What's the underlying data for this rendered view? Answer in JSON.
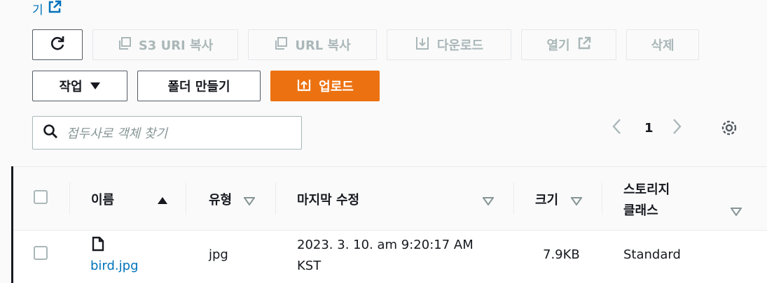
{
  "top_link": {
    "label": "기"
  },
  "toolbar": {
    "refresh_label": "",
    "copy_s3_uri": "S3 URI 복사",
    "copy_url": "URL 복사",
    "download": "다운로드",
    "open": "열기",
    "delete": "삭제",
    "actions": "작업",
    "create_folder": "폴더 만들기",
    "upload": "업로드"
  },
  "search": {
    "placeholder": "접두사로 객체 찾기"
  },
  "pagination": {
    "current_page": "1"
  },
  "table": {
    "columns": {
      "name": "이름",
      "type": "유형",
      "last_modified": "마지막 수정",
      "size": "크기",
      "storage_class_line1": "스토리지",
      "storage_class_line2": "클래스"
    },
    "rows": [
      {
        "name": "bird.jpg",
        "type": "jpg",
        "last_modified_line1": "2023. 3. 10. am 9:20:17 AM",
        "last_modified_line2": "KST",
        "size": "7.9KB",
        "storage_class": "Standard"
      }
    ]
  },
  "colors": {
    "accent": "#ec7211",
    "link": "#0073bb",
    "disabled": "#aab7b8"
  }
}
